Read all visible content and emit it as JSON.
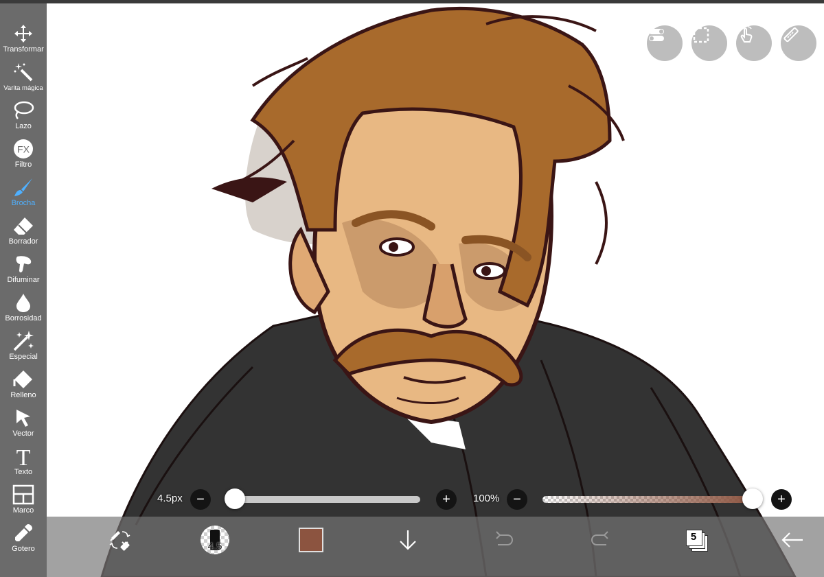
{
  "tools": [
    {
      "label": "Transformar",
      "icon": "move-arrows-icon"
    },
    {
      "label": "Varita mágica",
      "icon": "magic-wand-icon"
    },
    {
      "label": "Lazo",
      "icon": "lasso-icon"
    },
    {
      "label": "Filtro",
      "icon": "fx-icon",
      "glyph": "FX"
    },
    {
      "label": "Brocha",
      "icon": "brush-icon",
      "active": true
    },
    {
      "label": "Borrador",
      "icon": "eraser-icon"
    },
    {
      "label": "Difuminar",
      "icon": "smudge-finger-icon"
    },
    {
      "label": "Borrosidad",
      "icon": "blur-drop-icon"
    },
    {
      "label": "Especial",
      "icon": "special-sparkle-icon"
    },
    {
      "label": "Relleno",
      "icon": "fill-bucket-icon"
    },
    {
      "label": "Vector",
      "icon": "vector-cursor-icon"
    },
    {
      "label": "Texto",
      "icon": "text-icon",
      "glyph": "T"
    },
    {
      "label": "Marco",
      "icon": "frame-divider-icon"
    },
    {
      "label": "Gotero",
      "icon": "eyedropper-icon"
    }
  ],
  "quick_actions": [
    "toggle-icon",
    "selection-icon",
    "gesture-hand-icon",
    "ruler-icon"
  ],
  "brush_size": {
    "label": "4.5px",
    "value": 4.5,
    "fraction": 0.0
  },
  "opacity": {
    "label": "100%",
    "value": 100,
    "fraction": 1.0
  },
  "bottom_bar": {
    "brush_preview_value": "4.5",
    "color": "#8c5440",
    "layer_count": "5",
    "icons": [
      "swap-tool-icon",
      "brush-preview-icon",
      "color-swatch-icon",
      "download-arrow-icon",
      "undo-icon",
      "redo-icon",
      "layers-icon",
      "back-arrow-icon"
    ]
  },
  "colors": {
    "sidebar": "#6b6b6b",
    "accent": "#4fb0ff",
    "coat": "#333333",
    "hair": "#a86a2c",
    "skin": "#e8b883",
    "line": "#3a1515"
  }
}
